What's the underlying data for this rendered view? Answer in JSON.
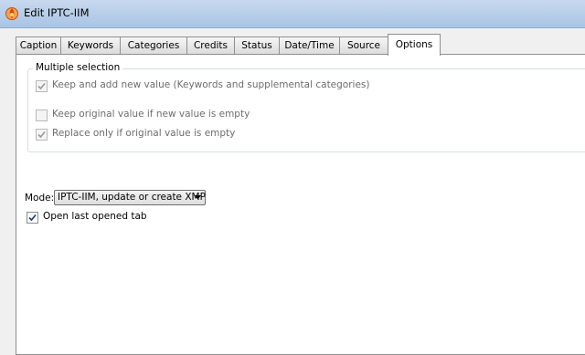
{
  "window": {
    "title": "Edit IPTC-IIM"
  },
  "tabs": [
    {
      "label": "Caption",
      "active": false
    },
    {
      "label": "Keywords",
      "active": false
    },
    {
      "label": "Categories",
      "active": false
    },
    {
      "label": "Credits",
      "active": false
    },
    {
      "label": "Status",
      "active": false
    },
    {
      "label": "Date/Time",
      "active": false
    },
    {
      "label": "Source",
      "active": false
    },
    {
      "label": "Options",
      "active": true
    }
  ],
  "options": {
    "multiple_selection": {
      "title": "Multiple selection",
      "keep_and_add": {
        "label": "Keep and add new value (Keywords and supplemental categories)",
        "checked": true,
        "enabled": false
      },
      "keep_original": {
        "label": "Keep original value if new value is empty",
        "checked": false,
        "enabled": false
      },
      "replace_only": {
        "label": "Replace only if original value is empty",
        "checked": true,
        "enabled": false
      }
    },
    "mode": {
      "label": "Mode:",
      "selected": "IPTC-IIM, update or create XMP"
    },
    "open_last_tab": {
      "label": "Open last opened tab",
      "checked": true,
      "enabled": true
    }
  },
  "colors": {
    "titlebar": "#b7cfea",
    "panel_bg": "#ffffff",
    "window_bg": "#f0f0f0",
    "check_enabled": "#1f3a7a",
    "check_disabled": "#9a9a9a",
    "app_icon": "#e8641b"
  },
  "icons": {
    "app": "flame-app-icon",
    "dropdown": "chevron-down-icon",
    "check": "check-icon"
  }
}
